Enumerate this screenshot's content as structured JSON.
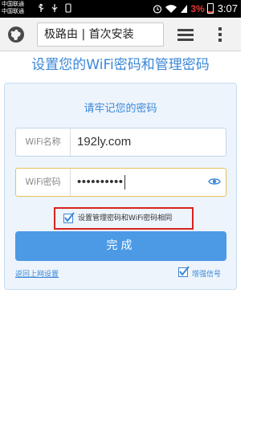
{
  "status_bar": {
    "carriers": [
      "中国联通",
      "中国联通"
    ],
    "battery_pct": "3%",
    "time": "3:07",
    "icons": [
      "usb-icon",
      "usb-debug-icon",
      "sim-icon",
      "alarm-icon",
      "wifi-icon",
      "signal-icon"
    ]
  },
  "browser": {
    "url_text": "极路由 | 首次安装",
    "icons": [
      "globe-icon",
      "tabs-icon",
      "overflow-menu-icon"
    ]
  },
  "page": {
    "title": "设置您的WiFi密码和管理密码",
    "subtitle": "请牢记您的密码",
    "wifi_name_label": "WiFi名称",
    "wifi_name_value": "192ly.com",
    "wifi_password_label": "WiFi密码",
    "wifi_password_value": "••••••••••",
    "same_password_label": "设置管理密码和WiFi密码相同",
    "same_password_checked": true,
    "done_label": "完成",
    "back_link": "返回上网设置",
    "boost_label": "增强信号",
    "boost_checked": true
  },
  "colors": {
    "accent": "#3a87d8",
    "button": "#4c9ae6",
    "highlight": "#d7231d",
    "battery_low": "#e53935"
  }
}
